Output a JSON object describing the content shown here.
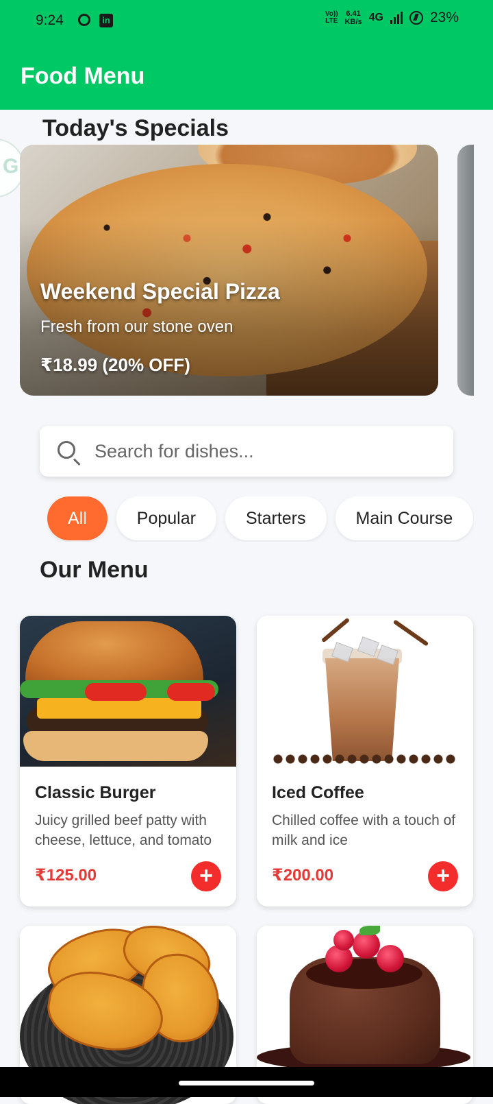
{
  "status_bar": {
    "time": "9:24",
    "network_top": "VoLTE",
    "speed_value": "6.41",
    "speed_unit": "KB/s",
    "network_type": "4G",
    "battery_percent": "23%"
  },
  "app_bar": {
    "title": "Food Menu"
  },
  "specials": {
    "heading": "Today's Specials",
    "items": [
      {
        "name": "Weekend Special Pizza",
        "description": "Fresh from our stone oven",
        "price": "₹18.99 (20% OFF)",
        "image": "pizza"
      }
    ]
  },
  "search": {
    "placeholder": "Search for dishes...",
    "value": "",
    "icon": "search-icon"
  },
  "categories": {
    "items": [
      "All",
      "Popular",
      "Starters",
      "Main Course"
    ],
    "active": "All"
  },
  "menu": {
    "heading": "Our Menu",
    "items": [
      {
        "name": "Classic Burger",
        "description": "Juicy grilled beef patty with cheese, lettuce, and tomato",
        "price": "₹125.00",
        "image": "burger"
      },
      {
        "name": "Iced Coffee",
        "description": "Chilled coffee with a touch of milk and ice",
        "price": "₹200.00",
        "image": "iced-coffee"
      },
      {
        "name": "",
        "description": "",
        "price": "",
        "image": "garlic-bread"
      },
      {
        "name": "",
        "description": "",
        "price": "",
        "image": "chocolate-lava-cake"
      }
    ],
    "add_label": "+"
  },
  "colors": {
    "app_bar": "#00C865",
    "chip_active": "#FF6A2F",
    "price": "#E53935",
    "add_button": "#F32C2C",
    "background": "#F5F7FA"
  }
}
